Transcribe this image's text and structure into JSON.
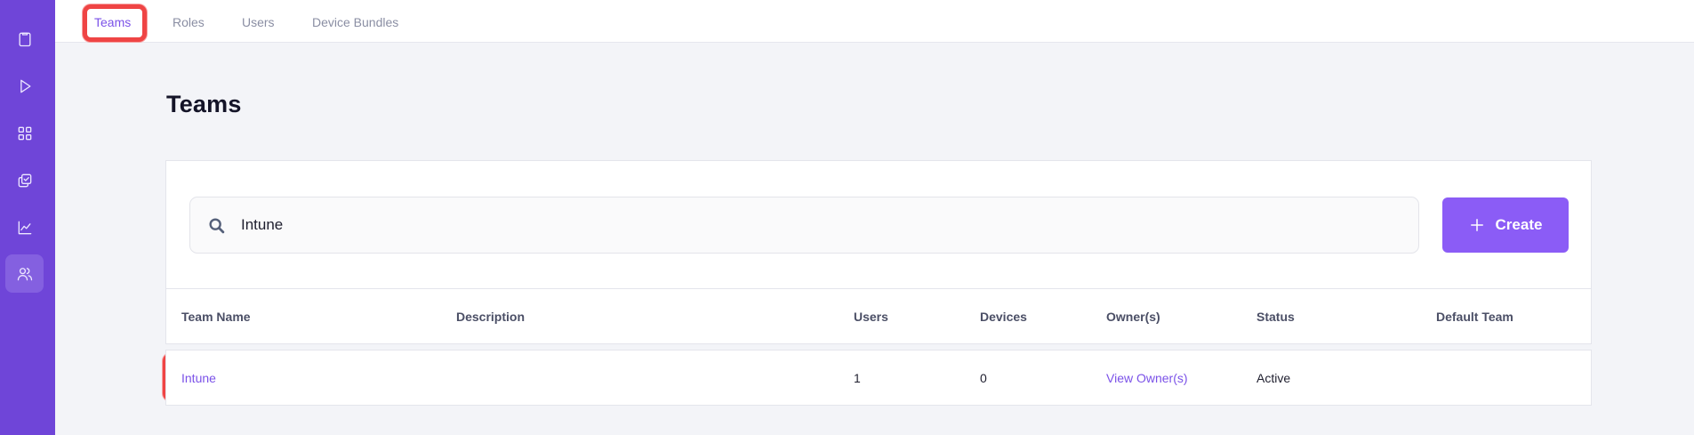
{
  "sidebar": {
    "items": [
      {
        "icon": "clipboard-icon"
      },
      {
        "icon": "play-icon"
      },
      {
        "icon": "grid-icon"
      },
      {
        "icon": "check-copy-icon"
      },
      {
        "icon": "chart-icon"
      },
      {
        "icon": "users-icon",
        "active": true
      }
    ]
  },
  "tabs": [
    {
      "label": "Teams",
      "active": true
    },
    {
      "label": "Roles"
    },
    {
      "label": "Users"
    },
    {
      "label": "Device Bundles"
    }
  ],
  "page": {
    "title": "Teams"
  },
  "search": {
    "value": "Intune"
  },
  "create_label": "Create",
  "table": {
    "headers": [
      "Team Name",
      "Description",
      "Users",
      "Devices",
      "Owner(s)",
      "Status",
      "Default Team"
    ],
    "rows": [
      {
        "team_name": "Intune",
        "description": "",
        "users": "1",
        "devices": "0",
        "owners": "View Owner(s)",
        "status": "Active",
        "default_team": ""
      }
    ]
  },
  "colors": {
    "accent": "#8b5cf6",
    "sidebar": "#6f45d8",
    "highlight": "#ef4444"
  }
}
